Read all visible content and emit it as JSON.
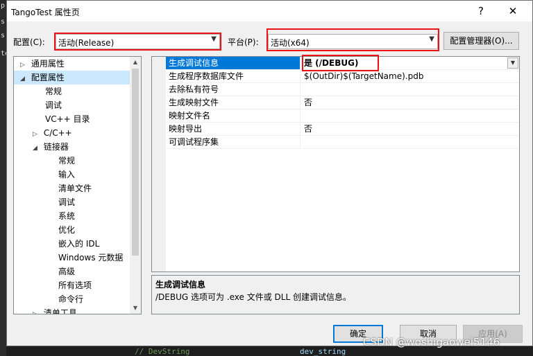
{
  "background": {
    "left_chars": [
      "p",
      "s",
      "s",
      "te"
    ],
    "bottom_left": "// DevString",
    "bottom_right": "dev_string"
  },
  "window": {
    "title": "TangoTest 属性页",
    "help": "?",
    "close": "✕"
  },
  "config": {
    "label": "配置(C):",
    "value": "活动(Release)"
  },
  "platform": {
    "label": "平台(P):",
    "value": "活动(x64)"
  },
  "config_manager_label": "配置管理器(O)...",
  "tree": [
    {
      "label": "通用属性",
      "toggle": "▷"
    },
    {
      "label": "配置属性",
      "toggle": "◢"
    },
    {
      "label": "常规",
      "toggle": ""
    },
    {
      "label": "调试",
      "toggle": ""
    },
    {
      "label": "VC++ 目录",
      "toggle": ""
    },
    {
      "label": "C/C++",
      "toggle": "▷"
    },
    {
      "label": "链接器",
      "toggle": "◢"
    },
    {
      "label": "常规",
      "toggle": ""
    },
    {
      "label": "输入",
      "toggle": ""
    },
    {
      "label": "清单文件",
      "toggle": ""
    },
    {
      "label": "调试",
      "toggle": ""
    },
    {
      "label": "系统",
      "toggle": ""
    },
    {
      "label": "优化",
      "toggle": ""
    },
    {
      "label": "嵌入的 IDL",
      "toggle": ""
    },
    {
      "label": "Windows 元数据",
      "toggle": ""
    },
    {
      "label": "高级",
      "toggle": ""
    },
    {
      "label": "所有选项",
      "toggle": ""
    },
    {
      "label": "命令行",
      "toggle": ""
    },
    {
      "label": "清单工具",
      "toggle": "▷"
    }
  ],
  "properties": [
    {
      "name": "生成调试信息",
      "value": "是 (/DEBUG)"
    },
    {
      "name": "生成程序数据库文件",
      "value": "$(OutDir)$(TargetName).pdb"
    },
    {
      "name": "去除私有符号",
      "value": ""
    },
    {
      "name": "生成映射文件",
      "value": "否"
    },
    {
      "name": "映射文件名",
      "value": ""
    },
    {
      "name": "映射导出",
      "value": "否"
    },
    {
      "name": "可调试程序集",
      "value": ""
    }
  ],
  "description": {
    "title": "生成调试信息",
    "text": "/DEBUG 选项可为 .exe 文件或 DLL 创建调试信息。"
  },
  "buttons": {
    "ok": "确定",
    "cancel": "取消",
    "apply": "应用(A)"
  },
  "watermark": "CSDN @woshigaowei5146",
  "colors": {
    "selection": "#0078d7",
    "tree_selection": "#cce8ff",
    "highlight_box": "#e11111",
    "ok_border": "#0078d7"
  },
  "icons": {
    "dropdown": "chevron-down-icon",
    "expand": "triangle-right-icon",
    "collapse": "triangle-down-icon"
  }
}
